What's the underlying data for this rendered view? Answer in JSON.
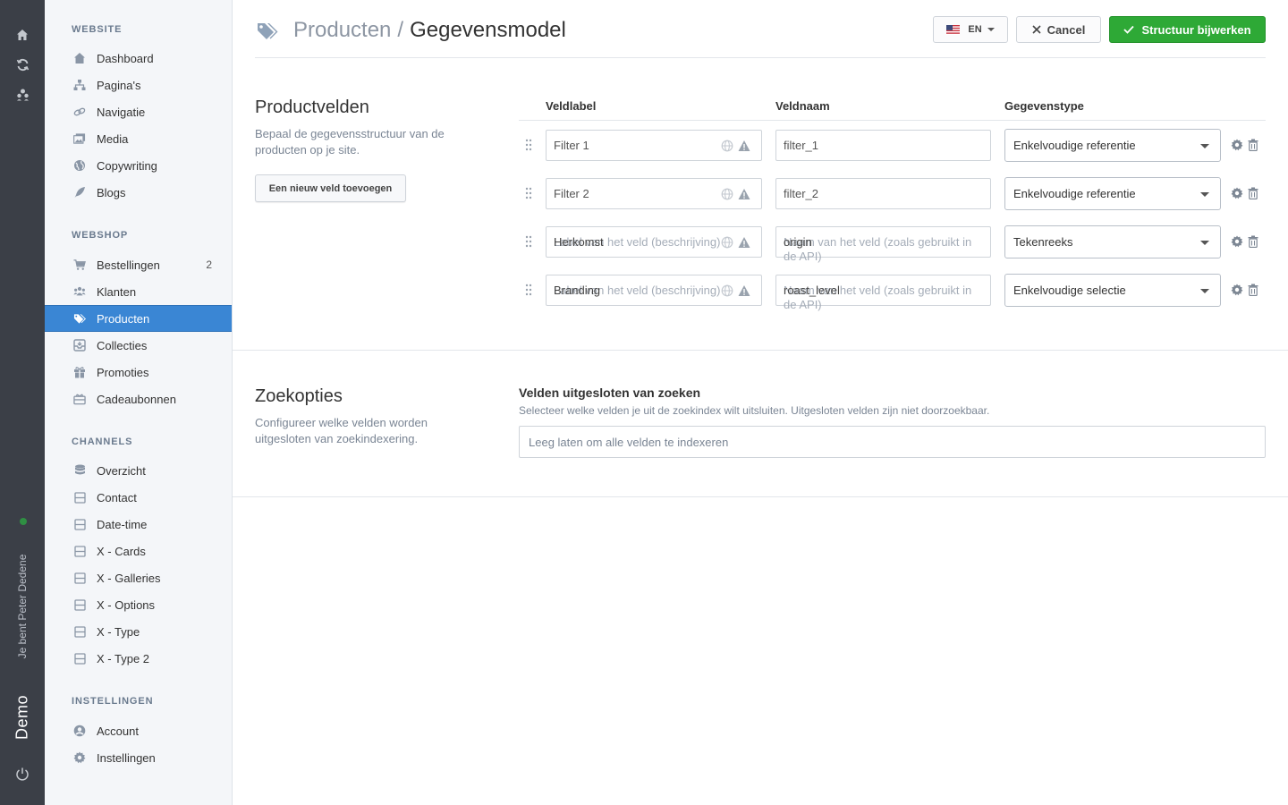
{
  "rail": {
    "user_text": "Je bent Peter Dedene",
    "brand": "Demo",
    "icons": [
      "home-icon",
      "refresh-icon",
      "users-icon",
      "power-icon"
    ]
  },
  "sidebar": {
    "sections": [
      {
        "title": "WEBSITE",
        "items": [
          {
            "label": "Dashboard",
            "icon": "home-icon"
          },
          {
            "label": "Pagina's",
            "icon": "sitemap-icon"
          },
          {
            "label": "Navigatie",
            "icon": "link-icon"
          },
          {
            "label": "Media",
            "icon": "images-icon"
          },
          {
            "label": "Copywriting",
            "icon": "globe-icon"
          },
          {
            "label": "Blogs",
            "icon": "feather-icon"
          }
        ]
      },
      {
        "title": "WEBSHOP",
        "items": [
          {
            "label": "Bestellingen",
            "icon": "cart-icon",
            "count": "2"
          },
          {
            "label": "Klanten",
            "icon": "users-icon"
          },
          {
            "label": "Producten",
            "icon": "tags-icon",
            "active": true
          },
          {
            "label": "Collecties",
            "icon": "inbox-icon"
          },
          {
            "label": "Promoties",
            "icon": "gift-icon"
          },
          {
            "label": "Cadeaubonnen",
            "icon": "giftcard-icon"
          }
        ]
      },
      {
        "title": "CHANNELS",
        "items": [
          {
            "label": "Overzicht",
            "icon": "database-icon"
          },
          {
            "label": "Contact",
            "icon": "channel-icon"
          },
          {
            "label": "Date-time",
            "icon": "channel-icon"
          },
          {
            "label": "X - Cards",
            "icon": "channel-icon"
          },
          {
            "label": "X - Galleries",
            "icon": "channel-icon"
          },
          {
            "label": "X - Options",
            "icon": "channel-icon"
          },
          {
            "label": "X - Type",
            "icon": "channel-icon"
          },
          {
            "label": "X - Type 2",
            "icon": "channel-icon"
          }
        ]
      },
      {
        "title": "INSTELLINGEN",
        "items": [
          {
            "label": "Account",
            "icon": "user-circle-icon"
          },
          {
            "label": "Instellingen",
            "icon": "gear-icon"
          }
        ]
      }
    ]
  },
  "header": {
    "crumb": "Producten",
    "separator": "/",
    "title": "Gegevensmodel",
    "lang": "EN",
    "cancel": "Cancel",
    "save": "Structuur bijwerken"
  },
  "fields_section": {
    "heading": "Productvelden",
    "description": "Bepaal de gegevensstructuur van de producten op je site.",
    "add_button": "Een nieuw veld toevoegen",
    "columns": [
      "Veldlabel",
      "Veldnaam",
      "Gegevenstype"
    ],
    "label_placeholder": "Label van het veld (beschrijving)",
    "name_placeholder": "Naam van het veld (zoals gebruikt in de API)",
    "rows": [
      {
        "label": "Filter 1",
        "name": "filter_1",
        "type": "Enkelvoudige referentie",
        "placeholder_visible": false
      },
      {
        "label": "Filter 2",
        "name": "filter_2",
        "type": "Enkelvoudige referentie",
        "placeholder_visible": false
      },
      {
        "label": "Herkomst",
        "name": "origin",
        "type": "Tekenreeks",
        "placeholder_visible": true
      },
      {
        "label": "Branding",
        "name": "roast_level",
        "type": "Enkelvoudige selectie",
        "placeholder_visible": true
      }
    ]
  },
  "search_section": {
    "heading": "Zoekopties",
    "description": "Configureer welke velden worden uitgesloten van zoekindexering.",
    "field_title": "Velden uitgesloten van zoeken",
    "field_help": "Selecteer welke velden je uit de zoekindex wilt uitsluiten. Uitgesloten velden zijn niet doorzoekbaar.",
    "placeholder": "Leeg laten om alle velden te indexeren"
  },
  "colors": {
    "accent": "#3a86d4",
    "success": "#2ea936",
    "rail": "#3b3f47",
    "sidebar_bg": "#f4f6f9"
  }
}
